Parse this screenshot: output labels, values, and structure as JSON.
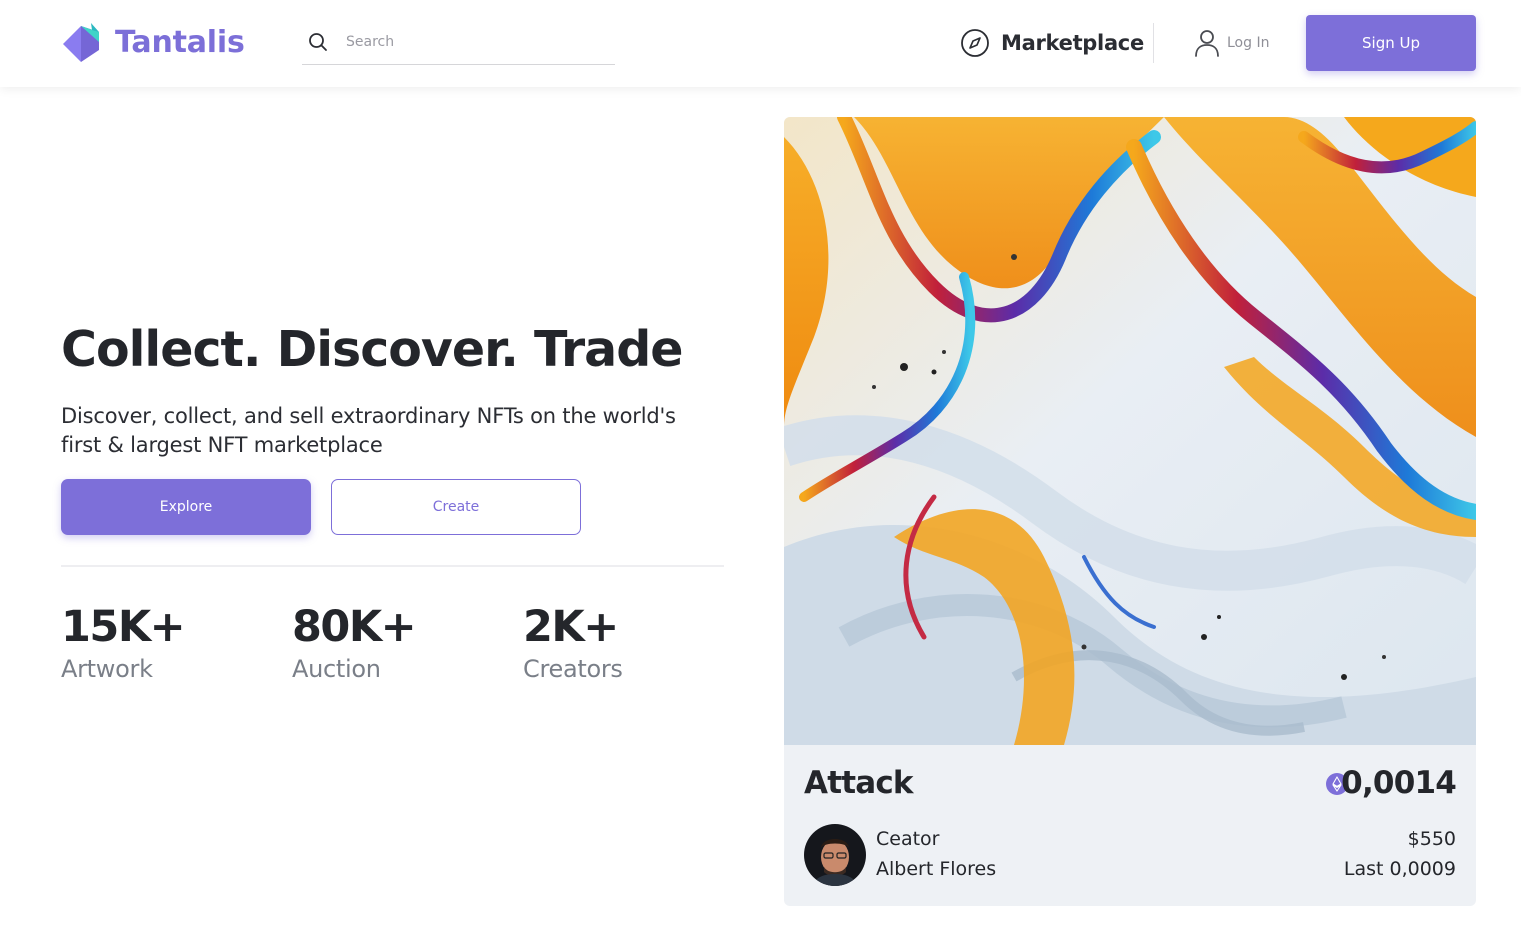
{
  "header": {
    "logo_text": "Tantalis",
    "search": {
      "placeholder": "Search",
      "value": ""
    },
    "nav": {
      "marketplace_label": "Marketplace",
      "login_label": "Log In",
      "signup_label": "Sign Up"
    }
  },
  "hero": {
    "title": "Collect. Discover. Trade",
    "subtitle": "Discover, collect, and sell extraordinary NFTs on the world's first & largest NFT marketplace",
    "explore_label": "Explore",
    "create_label": "Create",
    "stats": [
      {
        "value": "15K+",
        "label": "Artwork"
      },
      {
        "value": "80K+",
        "label": "Auction"
      },
      {
        "value": "2K+",
        "label": "Creators"
      }
    ]
  },
  "card": {
    "title": "Attack",
    "price_eth": "0,0014",
    "creator_label": "Ceator",
    "creator_name": "Albert Flores",
    "price_usd": "$550",
    "last_price": "Last 0,0009"
  },
  "icons": {
    "logo": "tantalis-logo-icon",
    "search": "search-icon",
    "marketplace": "compass-icon",
    "login": "user-icon",
    "currency": "ethereum-icon"
  },
  "colors": {
    "accent": "#7d6fd9",
    "logo_text": "#7c6fd8",
    "heading": "#24262b",
    "muted": "#7a7f88",
    "card_bg": "#eef1f5"
  }
}
